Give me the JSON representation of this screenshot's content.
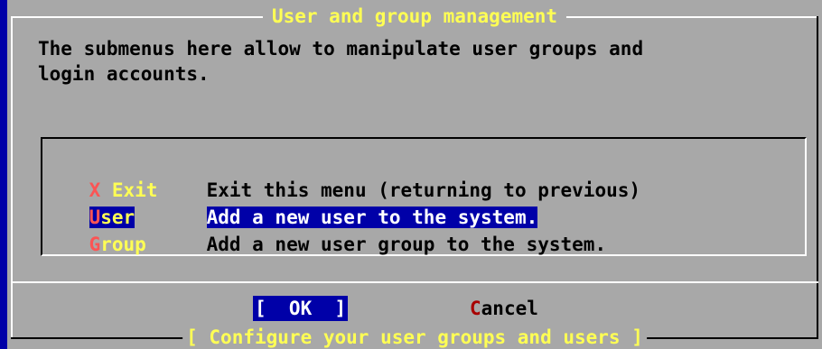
{
  "dialog": {
    "title": "User and group management",
    "description": "The submenus here allow to manipulate user groups and\nlogin accounts.",
    "footer": "[ Configure your user groups and users ]"
  },
  "menu": {
    "items": [
      {
        "hotkey": "X",
        "tag_rest": " Exit",
        "description": "Exit this menu (returning to previous)",
        "selected": false
      },
      {
        "hotkey": "U",
        "tag_rest": "ser",
        "description": "Add a new user to the system.",
        "selected": true
      },
      {
        "hotkey": "G",
        "tag_rest": "roup",
        "description": "Add a new user group to the system.",
        "selected": false
      }
    ]
  },
  "buttons": {
    "ok_label": "[  OK  ]",
    "cancel_hotkey": "C",
    "cancel_rest": "ancel"
  },
  "colors": {
    "background": "#0000a8",
    "dialog": "#a8a8a8",
    "title": "#ffff54",
    "hotkey": "#fc5454",
    "selection": "#0000a8"
  }
}
